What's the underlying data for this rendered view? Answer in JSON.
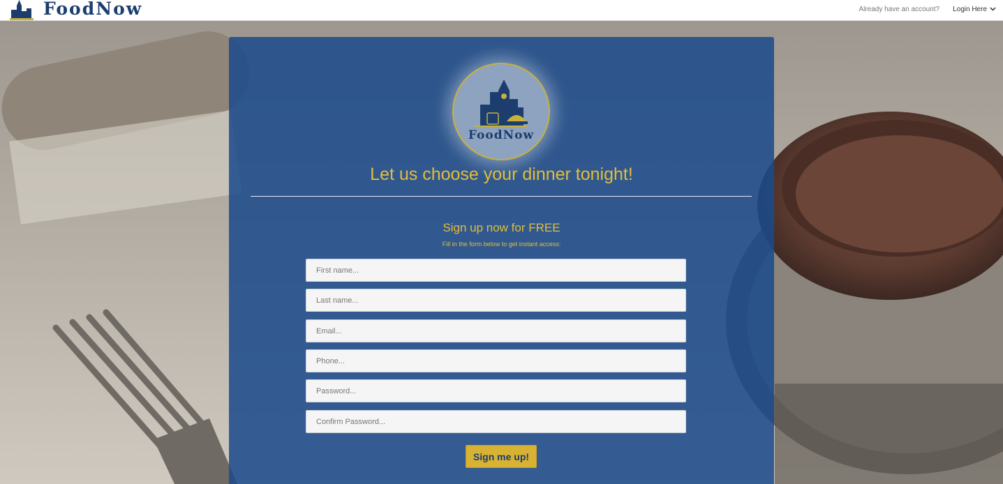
{
  "nav": {
    "brand_name": "FoodNow",
    "already_text": "Already have an account?",
    "login_label": "Login Here"
  },
  "signup": {
    "logo_text": "FoodNow",
    "tagline": "Let us choose your dinner tonight!",
    "title": "Sign up now for FREE",
    "subtitle": "Fill in the form below to get instant access:",
    "fields": {
      "first_name": {
        "placeholder": "First name..."
      },
      "last_name": {
        "placeholder": "Last name..."
      },
      "email": {
        "placeholder": "Email..."
      },
      "phone": {
        "placeholder": "Phone..."
      },
      "password": {
        "placeholder": "Password..."
      },
      "confirm_password": {
        "placeholder": "Confirm Password..."
      }
    },
    "submit_label": "Sign me up!"
  },
  "colors": {
    "brand_navy": "#1c3d6e",
    "accent_gold": "#e3bd3a",
    "button_gold": "#d8b232",
    "panel_blue": "#1b4b8c"
  },
  "icons": {
    "brand": "city-skyline-logo-icon",
    "login_dropdown": "chevron-down-icon"
  }
}
